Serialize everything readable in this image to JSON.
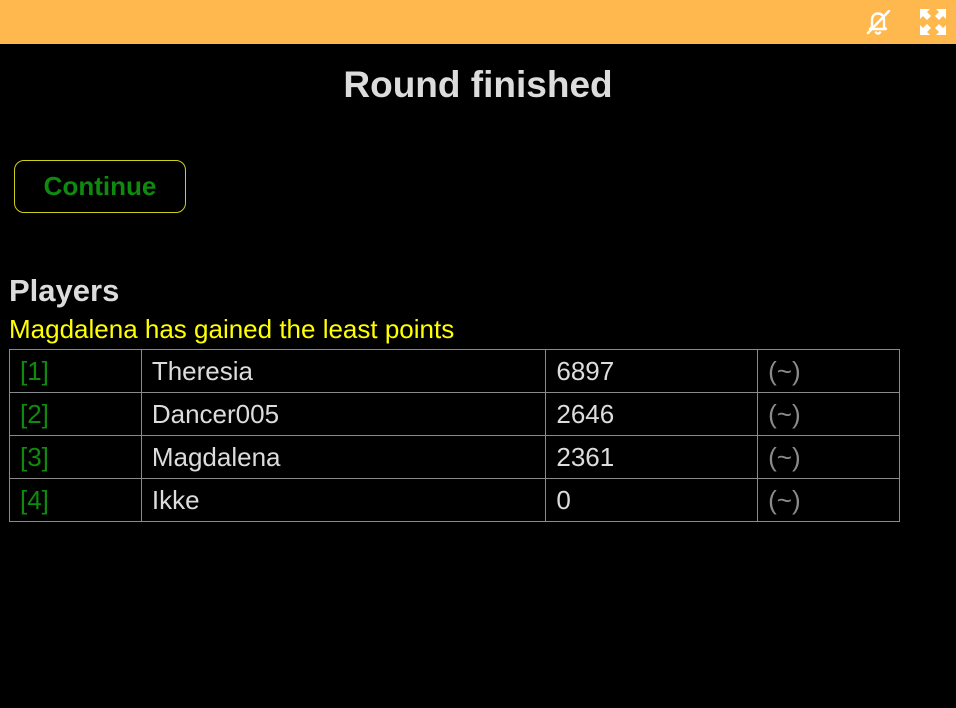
{
  "topbar": {
    "background": "#ffb84d",
    "icons": [
      "bell-off-icon",
      "fullscreen-icon"
    ]
  },
  "title": "Round finished",
  "continue_label": "Continue",
  "players_heading": "Players",
  "notice": "Magdalena has gained the least points",
  "players": [
    {
      "rank": "[1]",
      "name": "Theresia",
      "score": "6897",
      "change": "(~)"
    },
    {
      "rank": "[2]",
      "name": "Dancer005",
      "score": "2646",
      "change": "(~)"
    },
    {
      "rank": "[3]",
      "name": "Magdalena",
      "score": "2361",
      "change": "(~)"
    },
    {
      "rank": "[4]",
      "name": "Ikke",
      "score": "0",
      "change": "(~)"
    }
  ],
  "colors": {
    "rank": "#0f8a0f",
    "notice": "#ffff00",
    "button_border": "#cfcf1a",
    "text": "#dcdcdc"
  }
}
